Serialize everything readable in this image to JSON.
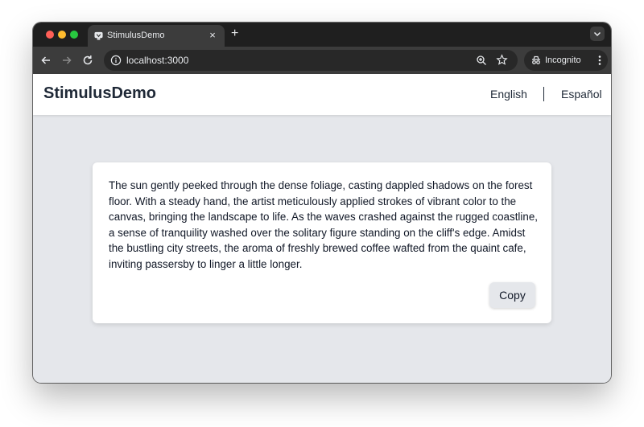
{
  "browser": {
    "tab_title": "StimulusDemo",
    "tab_close": "×",
    "new_tab": "+",
    "url": "localhost:3000",
    "incognito_label": "Incognito",
    "icons": [
      "favicon-icon",
      "back-icon",
      "forward-icon",
      "reload-icon",
      "info-icon",
      "zoom-icon",
      "star-icon",
      "incognito-icon",
      "menu-icon",
      "tab-search-icon"
    ]
  },
  "header": {
    "brand": "StimulusDemo",
    "lang_en": "English",
    "lang_es": "Español"
  },
  "card": {
    "text": "The sun gently peeked through the dense foliage, casting dappled shadows on the forest floor. With a steady hand, the artist meticulously applied strokes of vibrant color to the canvas, bringing the landscape to life. As the waves crashed against the rugged coastline, a sense of tranquility washed over the solitary figure standing on the cliff's edge. Amidst the bustling city streets, the aroma of freshly brewed coffee wafted from the quaint cafe, inviting passersby to linger a little longer.",
    "copy_label": "Copy"
  },
  "colors": {
    "page_bg": "#e5e7eb",
    "header_bg": "#ffffff",
    "text": "#111827",
    "button_bg": "#e5e7eb"
  }
}
